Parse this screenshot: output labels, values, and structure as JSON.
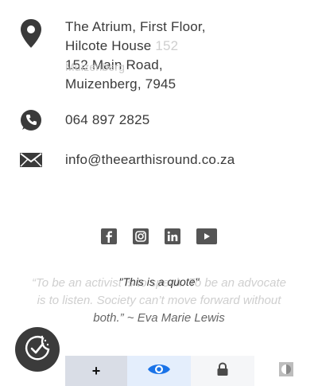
{
  "contact": {
    "address_lines": [
      "The Atrium, First Floor,",
      "Hilcote House",
      "152 Main Road,",
      "Muizenberg, 7945"
    ],
    "address_ghost": [
      "152",
      "Muizenberg"
    ],
    "phone": "064 897 2825",
    "email": "info@theearthisround.co.za"
  },
  "icons": {
    "address": "map-marker-icon",
    "phone": "phone-icon",
    "email": "envelope-icon",
    "badge": "accessibility-icon",
    "social": [
      "facebook-icon",
      "instagram-icon",
      "linkedin-icon",
      "youtube-icon"
    ]
  },
  "quote": {
    "overlay": "\"This is a quote\"",
    "lines": [
      "“To be an activist is to speak. To be an advocate",
      "is to listen. Society can’t move forward without",
      "both.” ~ Eva Marie Lewis"
    ]
  },
  "toolbar": {
    "add_label": "+"
  },
  "colors": {
    "text": "#3a3a3a",
    "ghost_text": "#cfcfcf",
    "badge": "#3b3b3b",
    "eye_icon": "#1a73e8",
    "toolbar_active": "#e4eefc"
  }
}
